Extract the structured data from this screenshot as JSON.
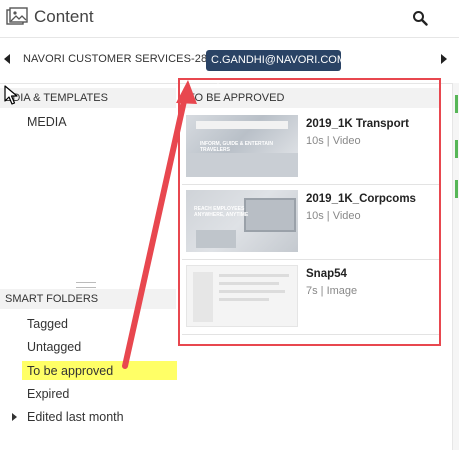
{
  "header": {
    "title": "Content",
    "icon": "content-icon",
    "search_icon": "search-icon"
  },
  "account_bar": {
    "account": "NAVORI CUSTOMER SERVICES-28735",
    "user": "C.GANDHI@NAVORI.COM",
    "pill_color": "#2a4365"
  },
  "sidebar": {
    "media_section": "EDIA & TEMPLATES",
    "media_items": [
      "MEDIA"
    ],
    "smart_section": "SMART FOLDERS",
    "folders": [
      {
        "label": "Tagged"
      },
      {
        "label": "Untagged"
      },
      {
        "label": "To be approved",
        "highlighted": true
      },
      {
        "label": "Expired"
      },
      {
        "label": "Edited last month",
        "expandable": true
      }
    ]
  },
  "panel": {
    "title": "TO BE APPROVED",
    "items": [
      {
        "title": "2019_1K Transport",
        "meta": "10s | Video",
        "thumb_caption": "INFORM, GUIDE & ENTERTAIN TRAVELERS"
      },
      {
        "title": "2019_1K_Corpcoms",
        "meta": "10s | Video",
        "thumb_caption": "REACH EMPLOYEES ANYWHERE, ANYTIME"
      },
      {
        "title": "Snap54",
        "meta": "7s | Image"
      }
    ]
  },
  "colors": {
    "annotation": "#e8474f",
    "highlight": "#ffff66",
    "accent": "#57b657"
  }
}
